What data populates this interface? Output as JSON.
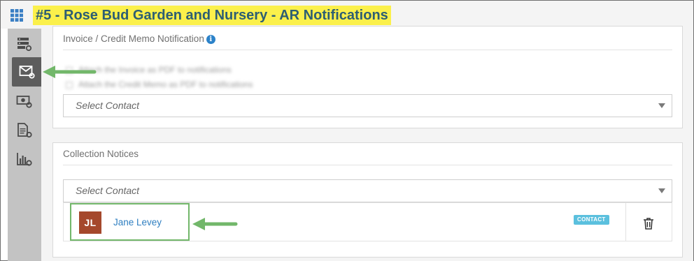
{
  "header": {
    "title": "#5 - Rose Bud Garden and Nursery - AR Notifications",
    "title_highlight_color": "#fbf04b",
    "title_color": "#2d5e73",
    "menu_icon": "apps-grid-icon"
  },
  "sidebar": {
    "items": [
      {
        "icon": "server-settings-icon",
        "active": false
      },
      {
        "icon": "envelope-settings-icon",
        "active": true
      },
      {
        "icon": "money-settings-icon",
        "active": false
      },
      {
        "icon": "document-settings-icon",
        "active": false
      },
      {
        "icon": "chart-settings-icon",
        "active": false
      }
    ]
  },
  "invoice_panel": {
    "title": "Invoice / Credit Memo Notification",
    "info_icon": "i",
    "blurred_options": [
      "Attach the Invoice as PDF to notifications",
      "Attach the Credit Memo as PDF to notifications"
    ],
    "contact_select": {
      "placeholder": "Select Contact"
    }
  },
  "collection_panel": {
    "title": "Collection Notices",
    "contact_select": {
      "placeholder": "Select Contact"
    },
    "contacts": [
      {
        "initials": "JL",
        "name": "Jane Levey",
        "badge": "CONTACT",
        "avatar_color": "#a5482c"
      }
    ]
  },
  "annotations": {
    "arrow_color": "#72b76a"
  }
}
